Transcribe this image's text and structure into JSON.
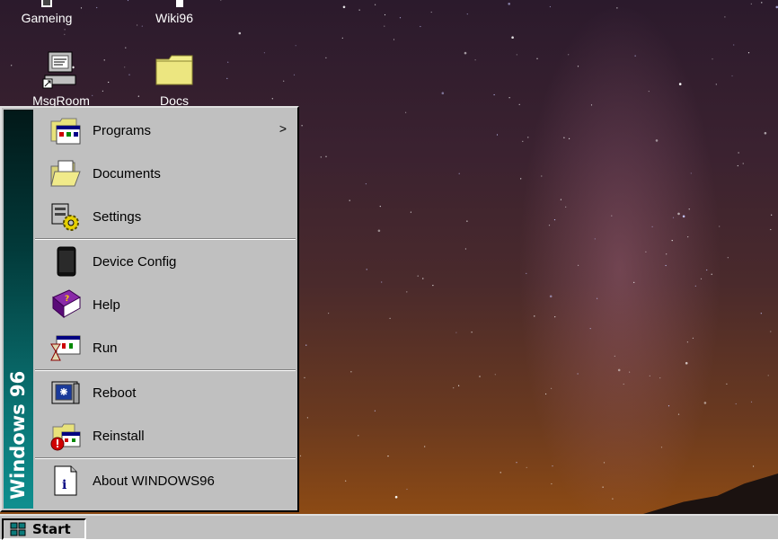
{
  "desktop": {
    "icons": [
      {
        "label": "Gameing",
        "icon": "gamepad-icon"
      },
      {
        "label": "Wiki96",
        "icon": "wiki-icon"
      },
      {
        "label": "MsgRoom",
        "icon": "chat-computer-icon"
      },
      {
        "label": "Docs",
        "icon": "folder-icon"
      }
    ]
  },
  "start_menu": {
    "banner": "Windows 96",
    "items": [
      {
        "label": "Programs",
        "icon": "programs-folder-icon",
        "has_submenu": true,
        "submenu_arrow": ">"
      },
      {
        "label": "Documents",
        "icon": "open-folder-icon"
      },
      {
        "label": "Settings",
        "icon": "settings-gear-icon"
      },
      {
        "label": "Device Config",
        "icon": "device-icon"
      },
      {
        "label": "Help",
        "icon": "help-book-icon"
      },
      {
        "label": "Run",
        "icon": "run-hourglass-icon"
      },
      {
        "label": "Reboot",
        "icon": "reboot-computer-icon"
      },
      {
        "label": "Reinstall",
        "icon": "reinstall-icon"
      },
      {
        "label": "About WINDOWS96",
        "icon": "info-icon"
      }
    ]
  },
  "taskbar": {
    "start_label": "Start"
  },
  "colors": {
    "menu_bg": "#c0c0c0",
    "banner_top": "#021818",
    "banner_bottom": "#0f8f8f"
  }
}
